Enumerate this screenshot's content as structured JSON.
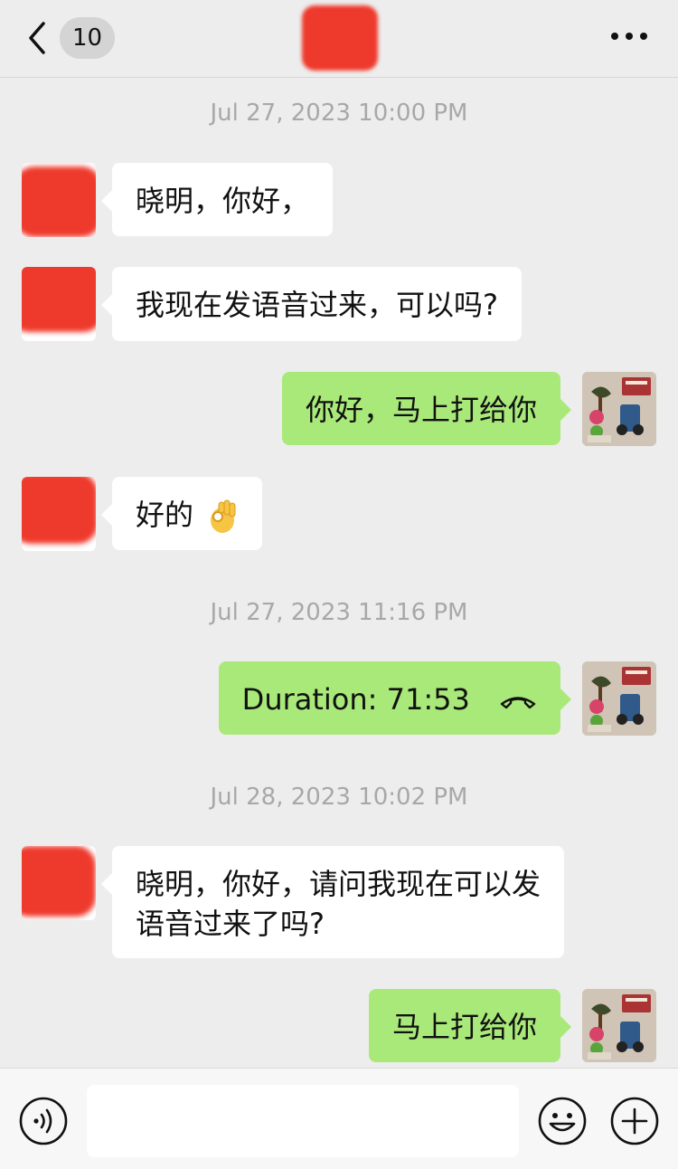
{
  "header": {
    "unread_count": "10",
    "back_icon": "chevron-left-icon",
    "more_icon": "more-dots-icon"
  },
  "messages": [
    {
      "type": "timestamp",
      "text": "Jul 27, 2023 10:00 PM"
    },
    {
      "type": "incoming",
      "text": "晓明，你好，"
    },
    {
      "type": "incoming",
      "text": "我现在发语音过来，可以吗?"
    },
    {
      "type": "outgoing",
      "text": "你好，马上打给你"
    },
    {
      "type": "incoming",
      "text": "好的",
      "emoji": "ok-hand-emoji"
    },
    {
      "type": "timestamp",
      "text": "Jul 27, 2023 11:16 PM"
    },
    {
      "type": "outgoing-call",
      "text": "Duration: 71:53",
      "icon": "call-ended-icon"
    },
    {
      "type": "timestamp",
      "text": "Jul 28, 2023 10:02 PM"
    },
    {
      "type": "incoming",
      "text": "晓明，你好，请问我现在可以发语音过来了吗?"
    },
    {
      "type": "outgoing",
      "text": "马上打给你"
    }
  ],
  "input_bar": {
    "voice_icon": "voice-input-icon",
    "input_value": "",
    "emoji_icon": "emoji-smile-icon",
    "plus_icon": "plus-circle-icon"
  },
  "colors": {
    "background": "#ededed",
    "incoming_bubble": "#ffffff",
    "outgoing_bubble": "#a9e97a",
    "redaction": "#ee3a2c",
    "timestamp_text": "#a8a8a8"
  }
}
